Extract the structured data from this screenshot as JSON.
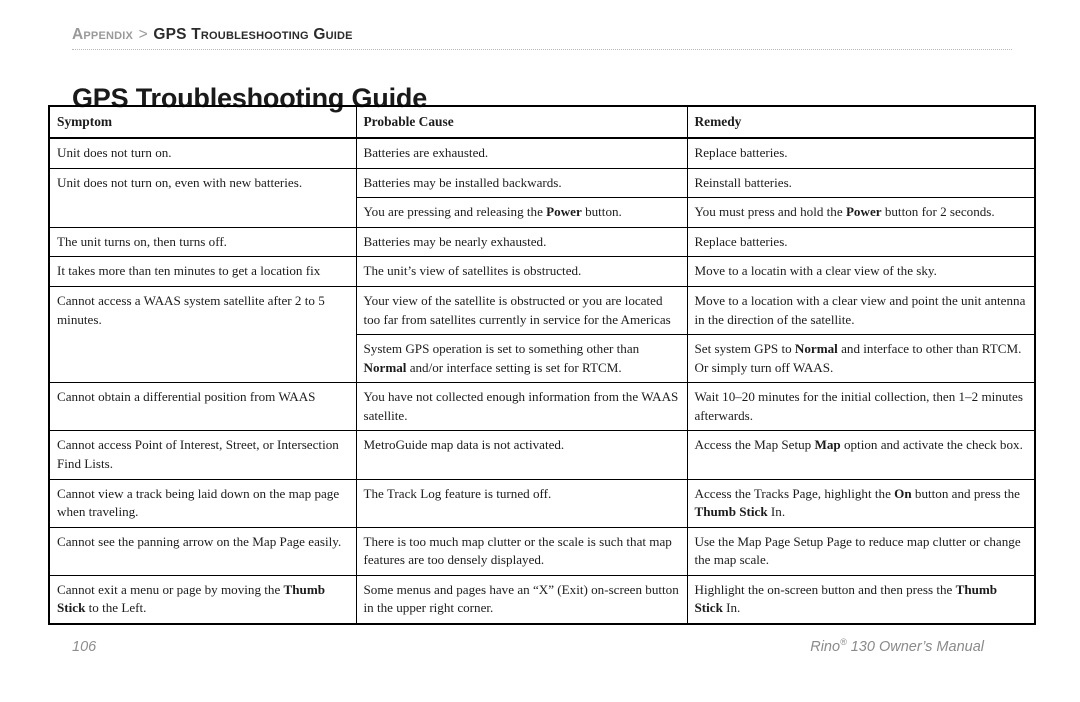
{
  "header": {
    "breadcrumb_parent": "Appendix",
    "breadcrumb_separator": ">",
    "breadcrumb_current": "GPS Troubleshooting Guide",
    "page_title": "GPS Troubleshooting Guide"
  },
  "table": {
    "columns": [
      "Symptom",
      "Probable Cause",
      "Remedy"
    ],
    "rows": [
      {
        "symptom": "Unit does not turn on.",
        "cause_html": "Batteries are exhausted.",
        "remedy_html": "Replace batteries."
      },
      {
        "symptom": "Unit does not turn on, even with new batteries.",
        "symptom_rowspan": 2,
        "cause_html": "Batteries may be installed backwards.",
        "remedy_html": "Reinstall batteries."
      },
      {
        "symptom": null,
        "cause_html": "You are pressing and releasing the <b>Power</b> button.",
        "remedy_html": "You must press and hold the <b>Power</b> button for 2 seconds."
      },
      {
        "symptom": "The unit turns on, then turns off.",
        "cause_html": "Batteries may be nearly exhausted.",
        "remedy_html": "Replace batteries."
      },
      {
        "symptom": "It takes more than ten minutes to get a location fix",
        "cause_html": "The unit’s view of satellites is obstructed.",
        "remedy_html": "Move to a locatin with a clear view of the sky."
      },
      {
        "symptom": "Cannot access a WAAS system satellite after 2 to 5 minutes.",
        "symptom_rowspan": 2,
        "cause_html": "Your view of the satellite is obstructed or you are located too far from satellites currently in service for the Americas",
        "remedy_html": "Move to a location with a clear view and point the unit antenna in the direction of the satellite."
      },
      {
        "symptom": null,
        "cause_html": "System GPS operation is set to something other than <b>Normal</b> and/or interface setting is set for RTCM.",
        "remedy_html": "Set system GPS to <b>Normal</b> and interface to other than RTCM. Or simply turn off WAAS."
      },
      {
        "symptom": "Cannot obtain a differential position from WAAS",
        "cause_html": "You have not collected enough information from the WAAS satellite.",
        "remedy_html": "Wait 10–20 minutes for the initial collection, then 1–2 minutes afterwards."
      },
      {
        "symptom": "Cannot access Point of Interest, Street, or Intersection Find Lists.",
        "cause_html": "MetroGuide map data is not activated.",
        "remedy_html": "Access the Map Setup <b>Map</b> option and activate the check box."
      },
      {
        "symptom": "Cannot view a track being laid down on the map page when traveling.",
        "cause_html": "The Track Log feature is turned off.",
        "remedy_html": "Access the Tracks Page, highlight the <b>On</b> button and press the <b>Thumb Stick</b> In."
      },
      {
        "symptom": "Cannot see the panning arrow on the Map Page easily.",
        "cause_html": "There is too much map clutter or the scale is such that map features are too densely displayed.",
        "remedy_html": "Use the Map Page Setup Page to reduce map clutter or change the map scale."
      },
      {
        "symptom_html": "Cannot exit a menu or page by moving the <b>Thumb Stick</b> to the Left.",
        "cause_html": "Some menus and pages have an “X” (Exit) on-screen button in the upper right corner.",
        "remedy_html": "Highlight the on-screen button and then press the <b>Thumb Stick</b> In."
      }
    ]
  },
  "footer": {
    "page_number": "106",
    "manual_name": "Rino",
    "manual_registered": "®",
    "manual_rest": " 130 Owner’s Manual"
  }
}
